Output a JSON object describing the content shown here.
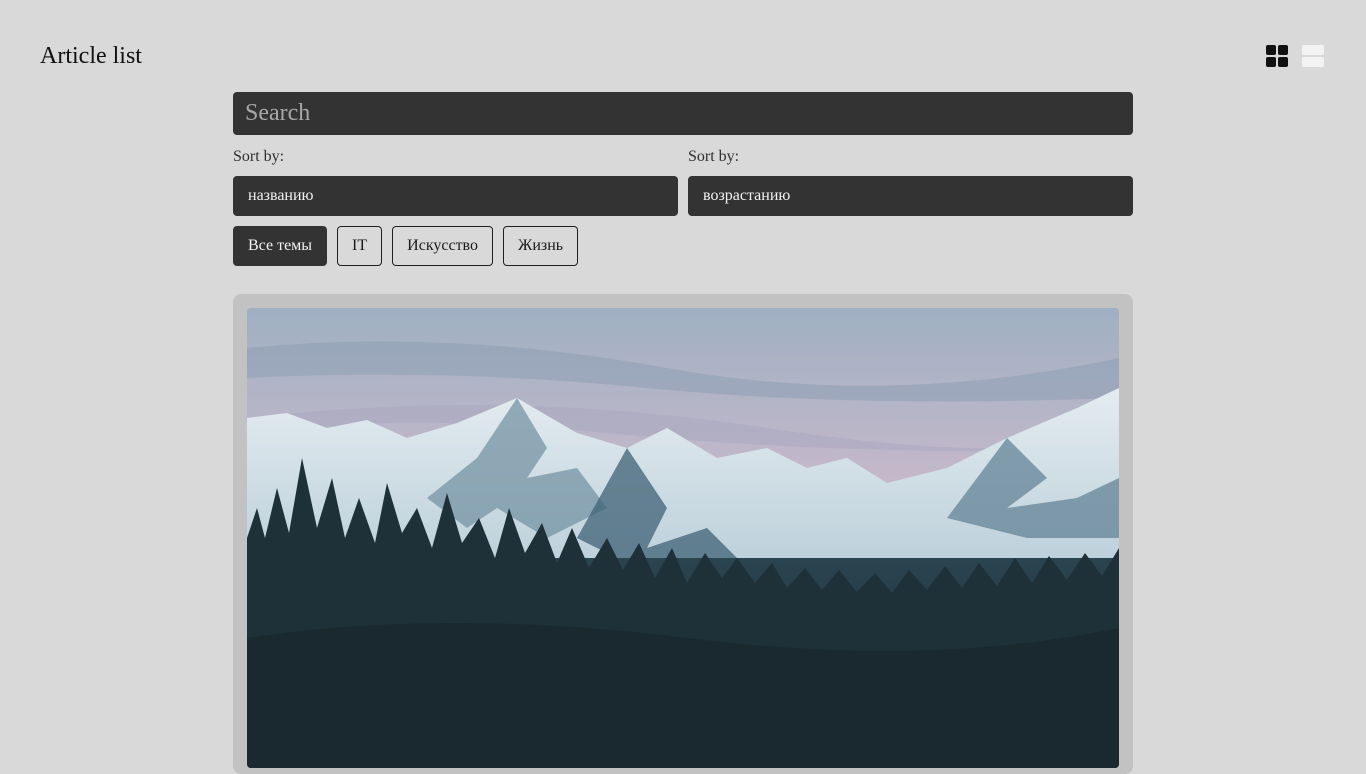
{
  "header": {
    "title": "Article list",
    "view_modes": [
      {
        "name": "grid-view",
        "icon": "grid-icon",
        "active": true
      },
      {
        "name": "list-view",
        "icon": "list-icon",
        "active": false
      }
    ]
  },
  "search": {
    "placeholder": "Search",
    "value": ""
  },
  "sort": {
    "field": {
      "label": "Sort by:",
      "value": "названию"
    },
    "order": {
      "label": "Sort by:",
      "value": "возрастанию"
    }
  },
  "tags": [
    {
      "label": "Все темы",
      "active": true
    },
    {
      "label": "IT",
      "active": false
    },
    {
      "label": "Искусство",
      "active": false
    },
    {
      "label": "Жизнь",
      "active": false
    }
  ],
  "articles": [
    {
      "image": "mountain-landscape-image"
    }
  ],
  "colors": {
    "background": "#d9d9d9",
    "control": "#333333",
    "card": "#c2c2c2",
    "sky_pink": "#d8b9c7",
    "forest": "#22363d"
  }
}
